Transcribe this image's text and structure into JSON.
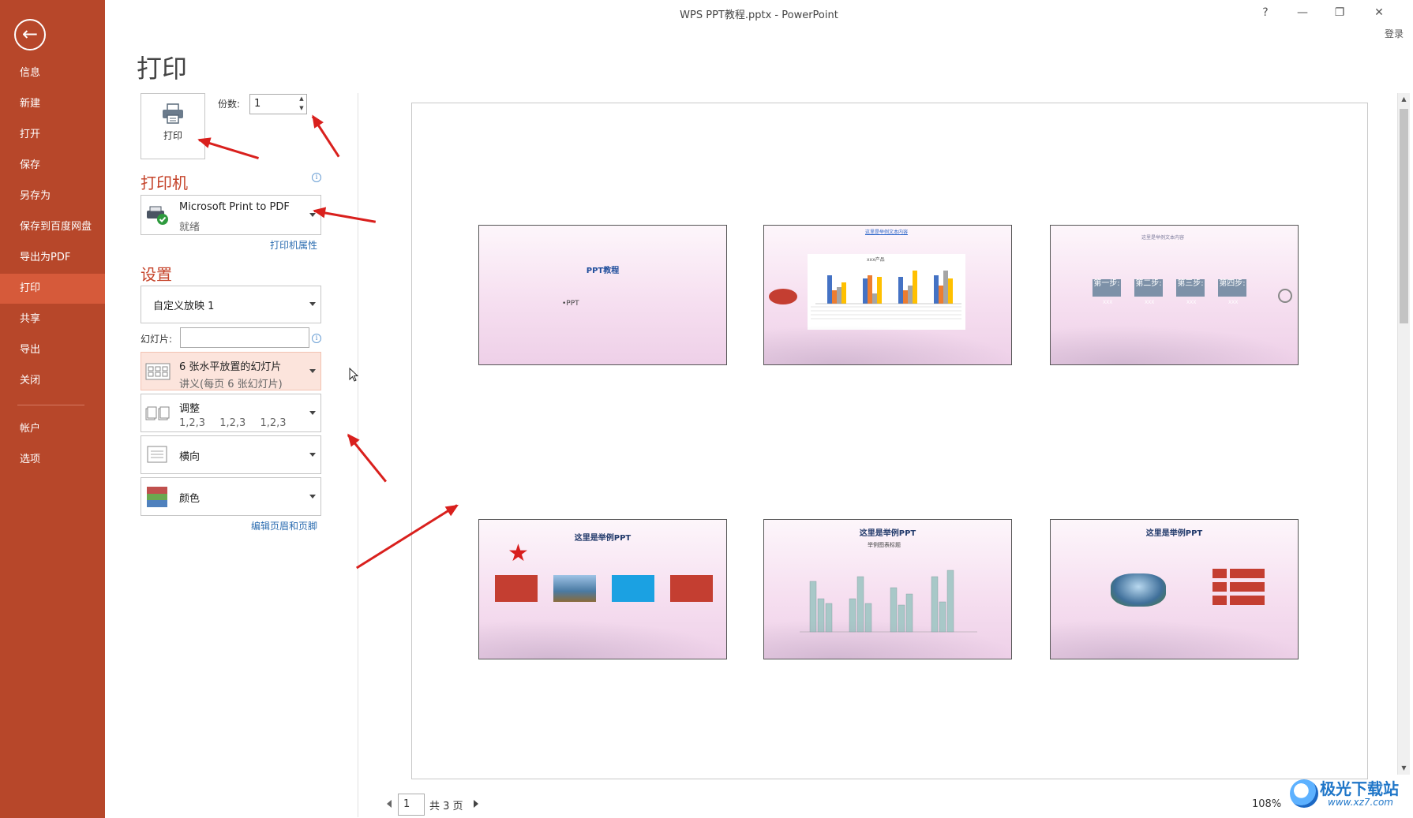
{
  "window": {
    "title": "WPS PPT教程.pptx - PowerPoint",
    "help": "?",
    "minimize": "—",
    "restore": "❐",
    "close": "✕",
    "login": "登录"
  },
  "nav": {
    "back_icon": "back-arrow-icon",
    "items": [
      {
        "label": "信息",
        "active": false
      },
      {
        "label": "新建",
        "active": false
      },
      {
        "label": "打开",
        "active": false
      },
      {
        "label": "保存",
        "active": false
      },
      {
        "label": "另存为",
        "active": false
      },
      {
        "label": "保存到百度网盘",
        "active": false
      },
      {
        "label": "导出为PDF",
        "active": false
      },
      {
        "label": "打印",
        "active": true
      },
      {
        "label": "共享",
        "active": false
      },
      {
        "label": "导出",
        "active": false
      },
      {
        "label": "关闭",
        "active": false
      }
    ],
    "bottom_items": [
      {
        "label": "帐户"
      },
      {
        "label": "选项"
      }
    ]
  },
  "print": {
    "heading": "打印",
    "print_button": "打印",
    "copies_label": "份数:",
    "copies_value": "1",
    "printer_section": "打印机",
    "printer_name": "Microsoft Print to PDF",
    "printer_status": "就绪",
    "printer_properties": "打印机属性",
    "settings_section": "设置",
    "slide_range": "自定义放映 1",
    "slides_label": "幻灯片:",
    "slides_value": "",
    "layout_line1": "6 张水平放置的幻灯片",
    "layout_line2": "讲义(每页 6 张幻灯片)",
    "collate_line1": "调整",
    "collate_line2": [
      "1,2,3",
      "1,2,3",
      "1,2,3"
    ],
    "orientation": "横向",
    "color": "颜色",
    "edit_header_footer": "编辑页眉和页脚"
  },
  "preview": {
    "slides": [
      {
        "title": "PPT教程",
        "body": "•PPT"
      },
      {
        "title": "这里是举例文本内容",
        "body": "xxx产品"
      },
      {
        "title": "这里是举例文本内容",
        "steps": [
          "第一步:",
          "第二步:",
          "第三步:",
          "第四步:"
        ],
        "step_sub": "XXX"
      },
      {
        "title": "这里是举例PPT",
        "body": ""
      },
      {
        "title": "这里是举例PPT",
        "body": "举例图表标题"
      },
      {
        "title": "这里是举例PPT",
        "body": ""
      }
    ],
    "page_value": "1",
    "page_total": "共 3 页",
    "zoom": "108%"
  },
  "colors": {
    "nav_bg": "#b7472a",
    "nav_active": "#d65a3a",
    "section": "#c5432a",
    "link": "#2b6cb0",
    "annotation_arrow": "#d9201d"
  },
  "watermark": {
    "text": "极光下载站",
    "url": "www.xz7.com"
  }
}
